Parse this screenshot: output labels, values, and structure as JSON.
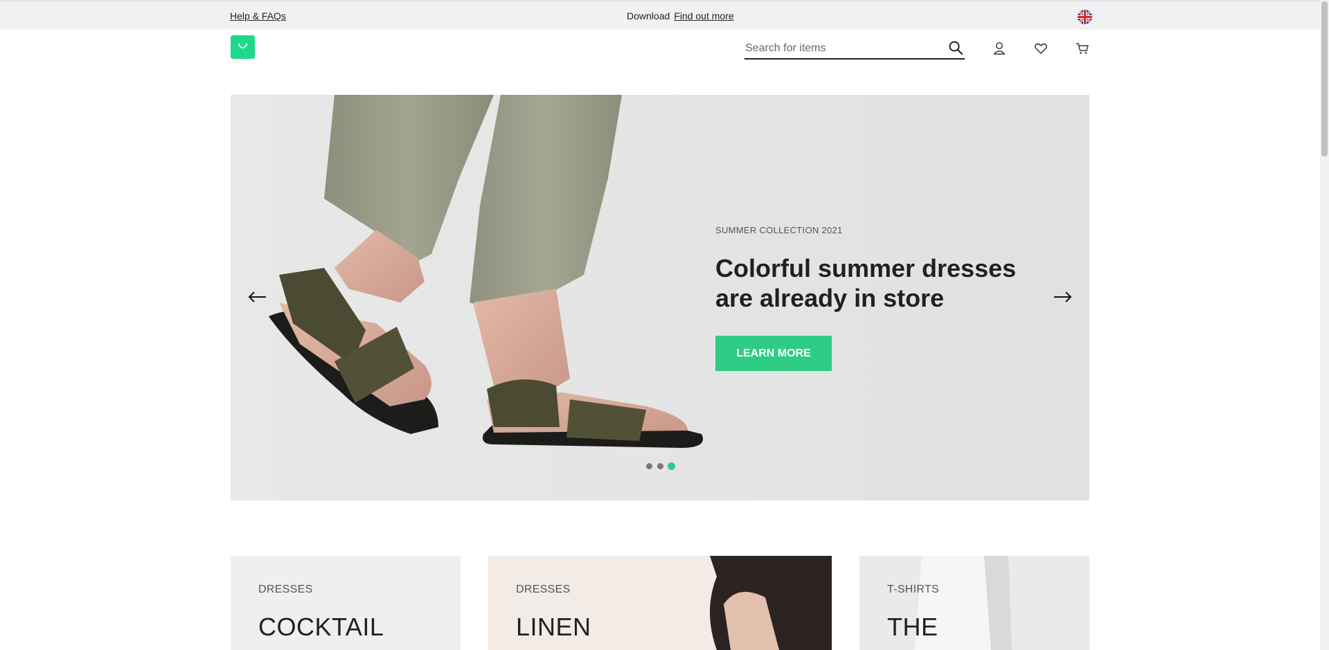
{
  "topbar": {
    "help_label": "Help & FAQs",
    "promo_text": "Download",
    "promo_link": "Find out more",
    "language_icon": "uk-flag-icon"
  },
  "header": {
    "logo_icon": "shopping-bag-icon",
    "search": {
      "placeholder": "Search for items",
      "value": ""
    },
    "icons": [
      "search-icon",
      "user-icon",
      "heart-icon",
      "cart-icon"
    ]
  },
  "hero": {
    "eyebrow": "SUMMER COLLECTION 2021",
    "headline": "Colorful summer dresses are already in store",
    "cta_label": "LEARN MORE",
    "slides_count": 3,
    "active_slide": 3
  },
  "categories": [
    {
      "category": "DRESSES",
      "title": "COCKTAIL"
    },
    {
      "category": "DRESSES",
      "title": "LINEN"
    },
    {
      "category": "T-SHIRTS",
      "title": "THE"
    }
  ],
  "colors": {
    "accent": "#2ecc85",
    "logo": "#1ed98c",
    "topbar_bg": "#f0f1f3",
    "text": "#1f2020"
  }
}
